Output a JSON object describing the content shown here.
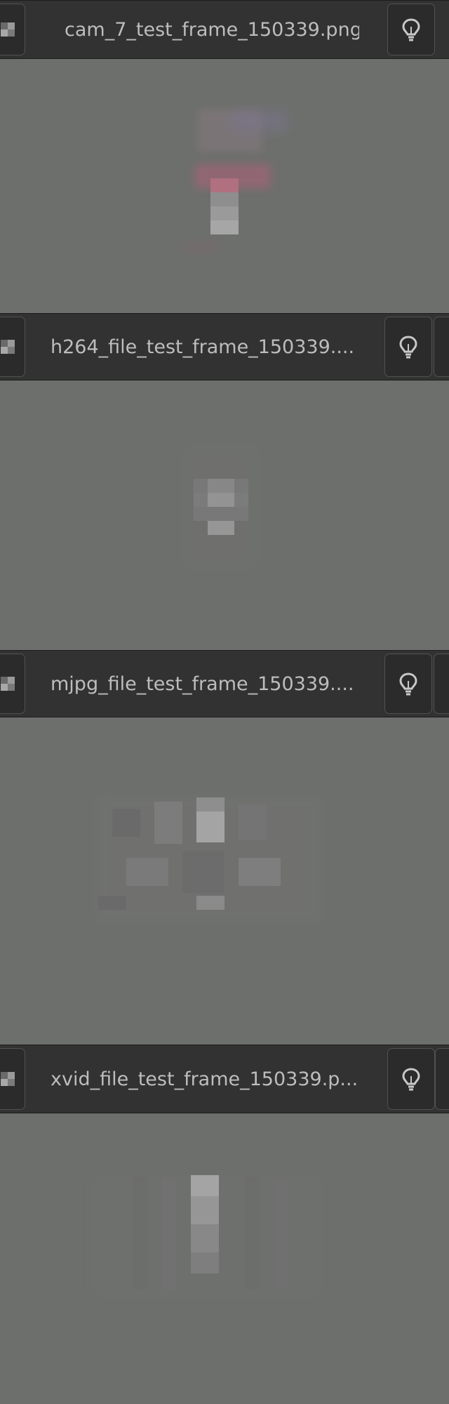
{
  "viewers": [
    {
      "title": "cam_7_test_frame_150339.png",
      "hint_icon": "lightbulb-icon",
      "grid_icon": "grid-icon"
    },
    {
      "title": "h264_file_test_frame_150339....",
      "hint_icon": "lightbulb-icon",
      "grid_icon": "grid-icon"
    },
    {
      "title": "mjpg_file_test_frame_150339....",
      "hint_icon": "lightbulb-icon",
      "grid_icon": "grid-icon"
    },
    {
      "title": "xvid_file_test_frame_150339.p...",
      "hint_icon": "lightbulb-icon",
      "grid_icon": "grid-icon"
    }
  ],
  "colors": {
    "header_bg": "#323232",
    "image_bg": "#6d6f6c",
    "title_text": "#bdbdbd"
  }
}
